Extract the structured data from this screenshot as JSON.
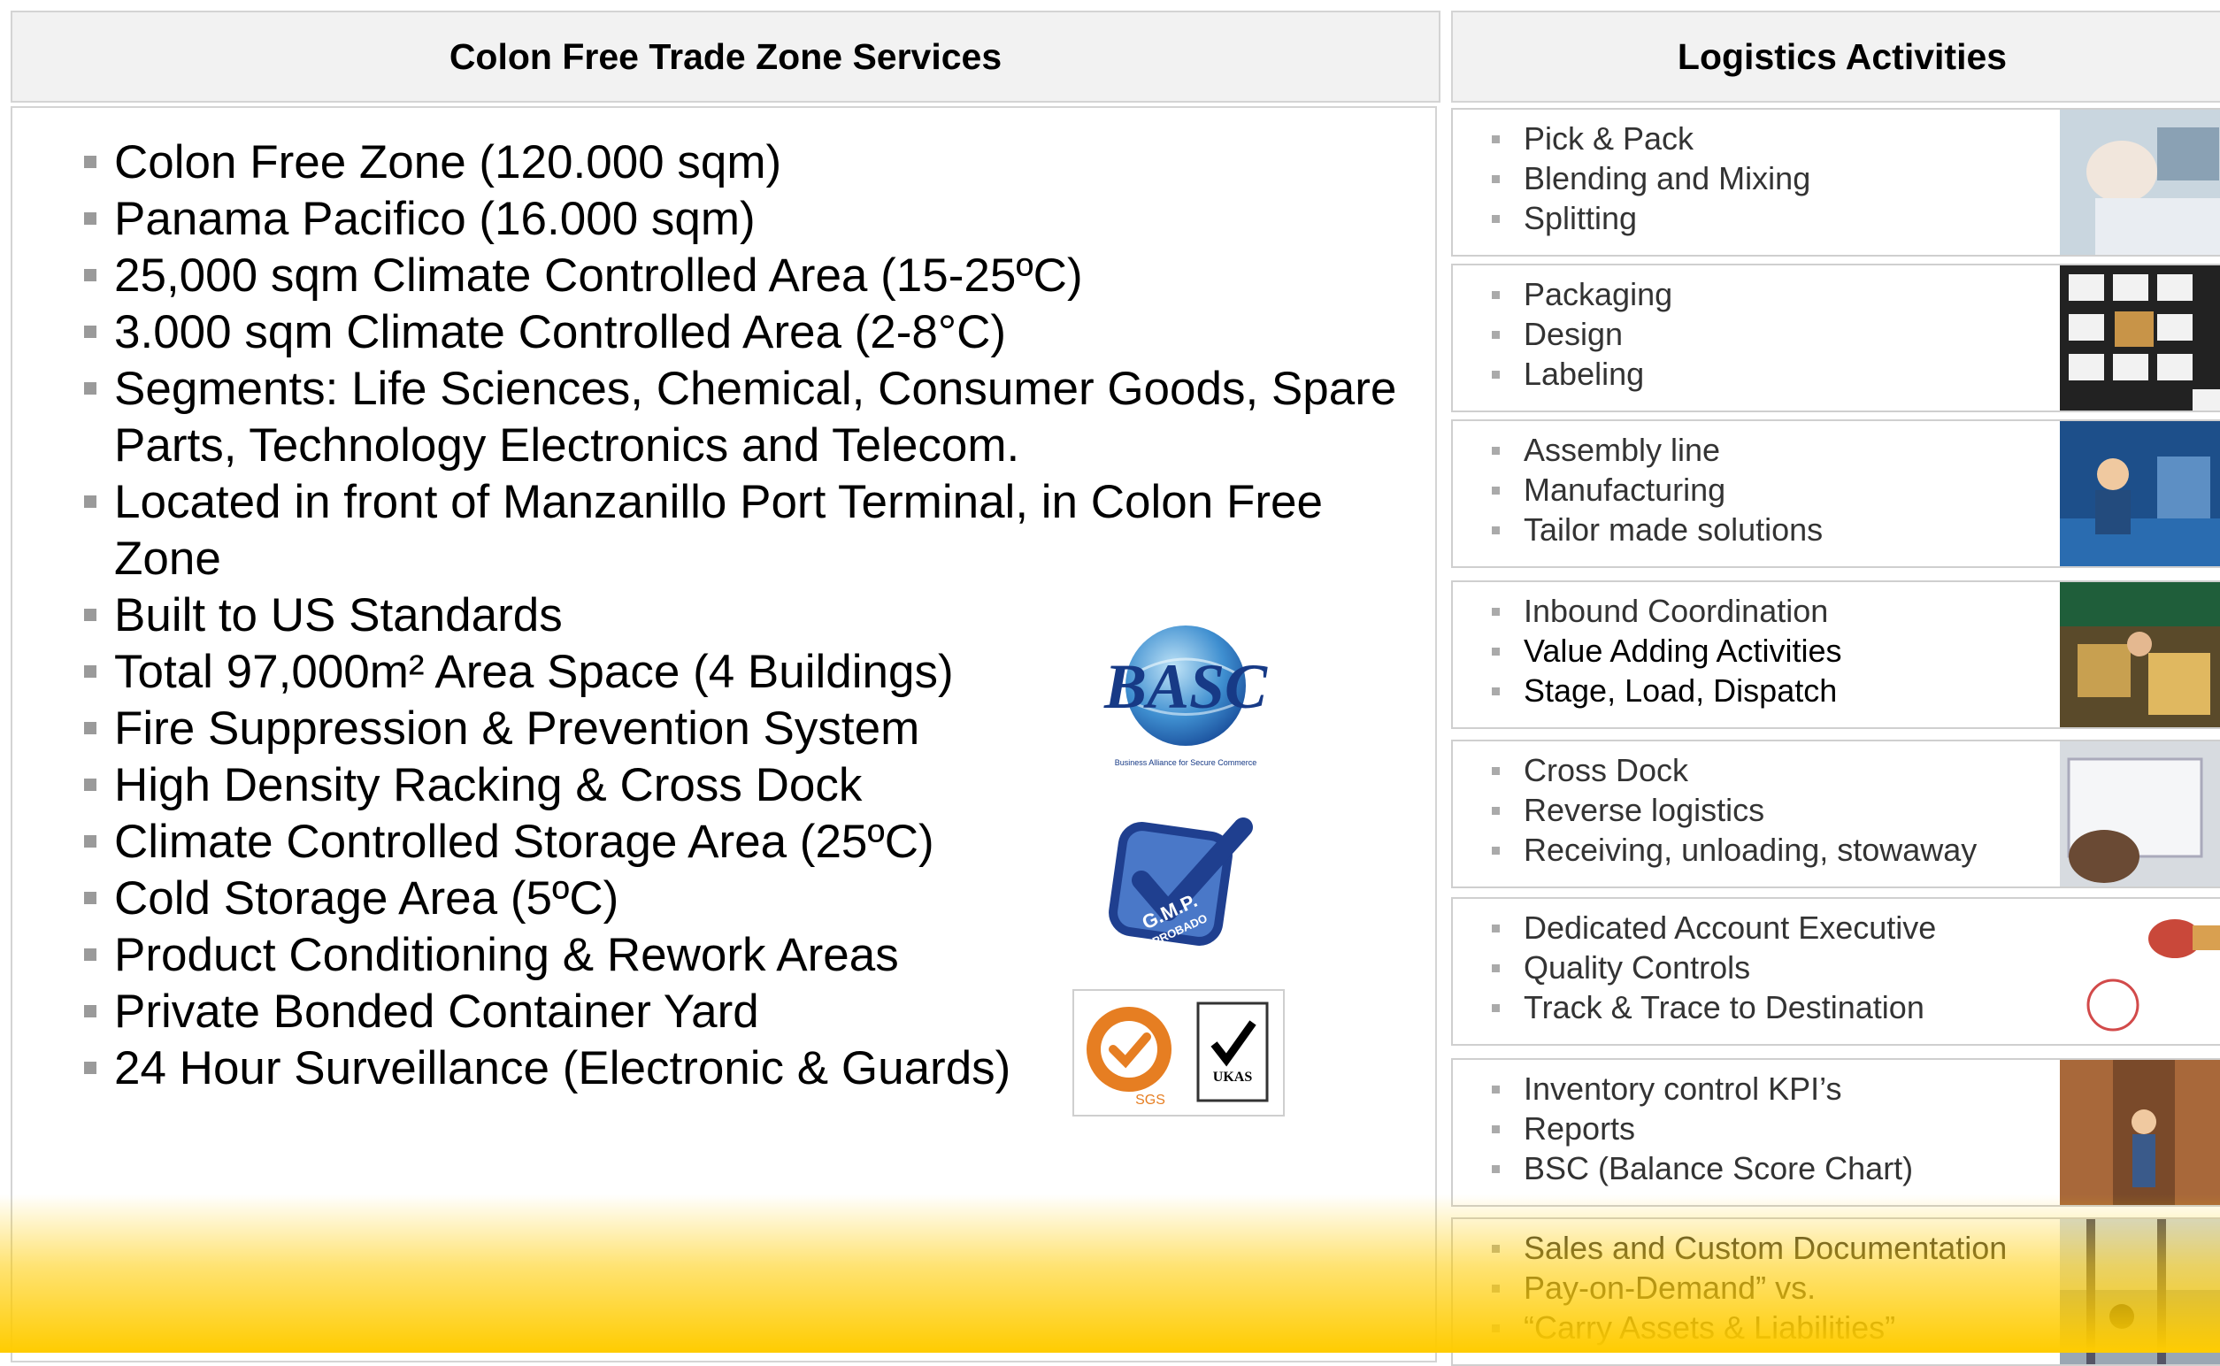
{
  "left": {
    "title": "Colon Free Trade Zone Services",
    "items": [
      "Colon Free Zone (120.000 sqm)",
      "Panama Pacifico (16.000 sqm)",
      "25,000 sqm Climate Controlled Area (15-25ºC)",
      "3.000 sqm Climate Controlled Area (2-8°C)",
      "Segments: Life Sciences, Chemical, Consumer Goods, Spare Parts, Technology Electronics and Telecom.",
      "Located in front of Manzanillo Port Terminal, in Colon Free Zone",
      "Built to US Standards",
      "Total 97,000m² Area Space (4 Buildings)",
      "Fire Suppression & Prevention System",
      "High Density Racking & Cross Dock",
      "Climate Controlled Storage Area (25ºC)",
      "Cold Storage Area (5ºC)",
      "Product Conditioning & Rework Areas",
      "Private Bonded Container Yard",
      "24 Hour Surveillance (Electronic & Guards)"
    ]
  },
  "logos": {
    "basc_text": "BASC",
    "basc_sub": "Business Alliance for Secure Commerce",
    "gmp_text": "G.M.P.",
    "gmp_sub": "APROBADO",
    "sgs_text": "SGS",
    "ukas_text": "UKAS"
  },
  "right": {
    "title": "Logistics Activities",
    "groups": [
      {
        "items": [
          "Pick & Pack",
          "Blending and Mixing",
          "Splitting"
        ],
        "image": "lab-worker-photo"
      },
      {
        "items": [
          "Packaging",
          "Design",
          "Labeling"
        ],
        "image": "boxes-grid-photo"
      },
      {
        "items": [
          "Assembly line",
          "Manufacturing",
          "Tailor made solutions"
        ],
        "image": "assembly-line-photo"
      },
      {
        "items": [
          "Inbound Coordination",
          "Value Adding Activities",
          "Stage, Load, Dispatch"
        ],
        "image": "warehouse-workers-photo"
      },
      {
        "items": [
          "Cross Dock",
          "Reverse logistics",
          "Receiving, unloading, stowaway"
        ],
        "image": "handling-photo"
      },
      {
        "items": [
          "Dedicated Account Executive",
          "Quality Controls",
          "Track & Trace to Destination"
        ],
        "image": "stamp-photo"
      },
      {
        "items": [
          "Inventory control KPI’s",
          "Reports",
          "BSC (Balance Score Chart)"
        ],
        "image": "storage-aisle-photo"
      },
      {
        "items": [
          "Sales and Custom Documentation",
          "Pay-on-Demand” vs.",
          "“Carry Assets & Liabilities”"
        ],
        "image": "office-view-photo"
      }
    ]
  }
}
